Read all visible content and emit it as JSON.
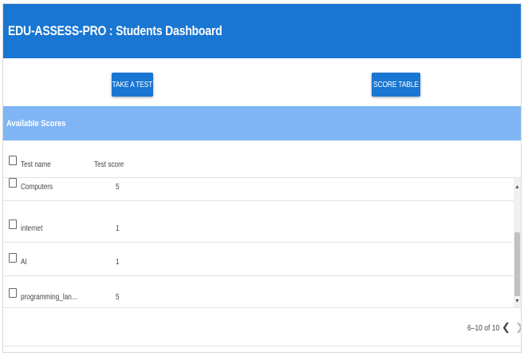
{
  "app": {
    "title": "EDU-ASSESS-PRO : Students Dashboard"
  },
  "actions": {
    "take_test": "TAKE A TEST",
    "score_table": "SCORE TABLE"
  },
  "section": {
    "title": "Available Scores"
  },
  "table": {
    "columns": [
      "Test name",
      "Test score"
    ],
    "rows": [
      {
        "name": "Computers",
        "score": "5"
      },
      {
        "name": "internet",
        "score": "1"
      },
      {
        "name": "AI",
        "score": "1"
      },
      {
        "name": "programming_lan...",
        "score": "5"
      }
    ]
  },
  "pagination": {
    "range": "6–10 of 10",
    "prev_icon": "chevron-left-icon",
    "next_icon": "chevron-right-icon"
  },
  "colors": {
    "header": "#1976d2",
    "section": "#7fb5f5",
    "button": "#1976d2"
  }
}
